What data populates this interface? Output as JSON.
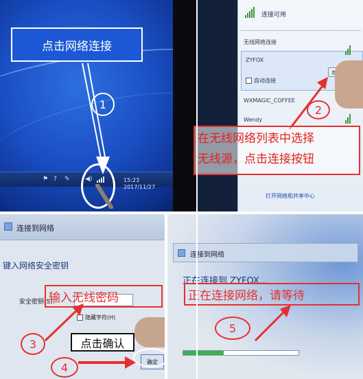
{
  "step1": {
    "callout": "点击网络连接",
    "number": "1",
    "clock_time": "15:23",
    "clock_date": "2017/11/27"
  },
  "step2": {
    "number": "2",
    "flyout_header": "连接可用",
    "section_label": "无线网络连接",
    "networks": [
      {
        "ssid": "ZYFOX"
      },
      {
        "ssid": "WXMAGIC_COFFEE"
      },
      {
        "ssid": "Wendy"
      }
    ],
    "auto_connect_label": "自动连接",
    "connect_button": "连接",
    "open_center_link": "打开网络和共享中心",
    "instruction_line1": "在无线网络列表中选择",
    "instruction_line2": "无线源，点击连接按钮"
  },
  "step3": {
    "number": "3",
    "window_title": "连接到网络",
    "prompt": "键入网络安全密钥",
    "key_label": "安全密钥(S):",
    "hide_chars_label": "隐藏字符(H)",
    "instruction": "输入无线密码",
    "ok_button": "确定"
  },
  "step4": {
    "number": "4",
    "instruction": "点击确认"
  },
  "step5": {
    "number": "5",
    "window_title": "连接到网络",
    "status_text": "正在连接到 ZYFOX...",
    "instruction": "正在连接网络，请等待",
    "progress": 0.35
  },
  "colors": {
    "annotation_red": "#e53030",
    "callout_blue": "#1c58d6"
  }
}
